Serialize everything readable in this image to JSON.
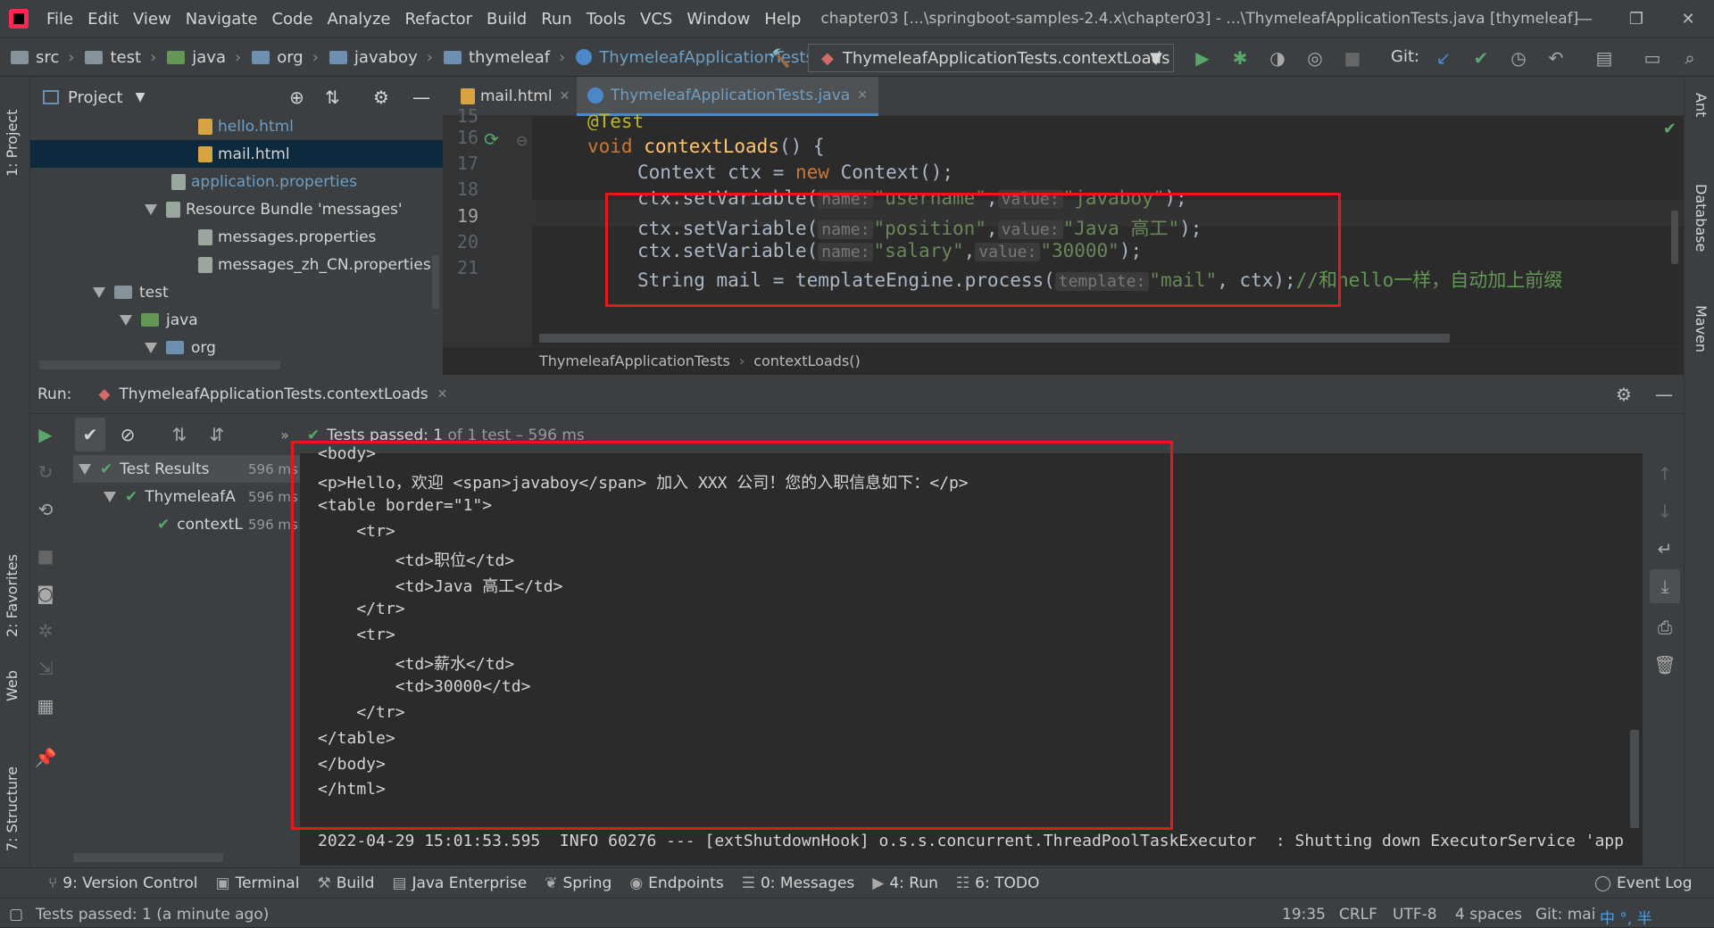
{
  "menubar": {
    "items": [
      "File",
      "Edit",
      "View",
      "Navigate",
      "Code",
      "Analyze",
      "Refactor",
      "Build",
      "Run",
      "Tools",
      "VCS",
      "Window",
      "Help"
    ],
    "title": "chapter03 [...\\springboot-samples-2.4.x\\chapter03] - ...\\ThymeleafApplicationTests.java [thymeleaf]"
  },
  "navbar": {
    "crumbs": [
      "src",
      "test",
      "java",
      "org",
      "javaboy",
      "thymeleaf"
    ],
    "class_crumb": "ThymeleafApplicationTests",
    "run_config": "ThymeleafApplicationTests.contextLoads",
    "git_label": "Git:"
  },
  "sidestrips": {
    "left": [
      "1: Project",
      "2: Favorites",
      "Web",
      "7: Structure"
    ],
    "right": [
      "Ant",
      "Database",
      "Maven"
    ]
  },
  "project": {
    "title": "Project",
    "items": [
      {
        "label": "hello.html"
      },
      {
        "label": "mail.html"
      },
      {
        "label": "application.properties"
      },
      {
        "label": "Resource Bundle 'messages'"
      },
      {
        "label": "messages.properties"
      },
      {
        "label": "messages_zh_CN.properties"
      },
      {
        "label": "test"
      },
      {
        "label": "java"
      },
      {
        "label": "org"
      }
    ]
  },
  "editor": {
    "tabs": [
      "mail.html",
      "ThymeleafApplicationTests.java"
    ],
    "line_numbers": [
      "15",
      "16",
      "17",
      "18",
      "19",
      "20",
      "21"
    ],
    "lines": {
      "l15": "@Test",
      "l16_kw": "void",
      "l16_fn": "contextLoads",
      "l16_rest": "() {",
      "l17_a": "Context ctx = ",
      "l17_kw": "new",
      "l17_b": " Context();",
      "l18_a": "ctx.setVariable(",
      "l18_h1": "name:",
      "l18_s1": "\"username\"",
      "l18_h2": "value:",
      "l18_s2": "\"javaboy\"",
      "l18_end": ");",
      "l19_a": "ctx.setVariable(",
      "l19_h1": "name:",
      "l19_s1": "\"position\"",
      "l19_h2": "value:",
      "l19_s2": "\"Java 高工\"",
      "l19_end": ");",
      "l20_a": "ctx.setVariable(",
      "l20_h1": "name:",
      "l20_s1": "\"salary\"",
      "l20_h2": "value:",
      "l20_s2": "\"30000\"",
      "l20_end": ");",
      "l21_a": "String mail = templateEngine.process(",
      "l21_h1": "template:",
      "l21_s1": "\"mail\"",
      "l21_b": ", ctx);",
      "l21_cmt": "//和hello一样，自动加上前缀"
    },
    "breadcrumb": [
      "ThymeleafApplicationTests",
      "contextLoads()"
    ]
  },
  "run": {
    "label": "Run:",
    "config": "ThymeleafApplicationTests.contextLoads",
    "status_prefix": "Tests passed:",
    "status_count": "1",
    "status_suffix": "of 1 test",
    "status_time": "– 596 ms",
    "tree": [
      {
        "label": "Test Results",
        "time": "596 ms"
      },
      {
        "label": "ThymeleafA",
        "time": "596 ms"
      },
      {
        "label": "contextL",
        "time": "596 ms"
      }
    ],
    "console": [
      "<body>",
      "<p>Hello，欢迎 <span>javaboy</span> 加入 XXX 公司！您的入职信息如下：</p>",
      "<table border=\"1\">",
      "    <tr>",
      "        <td>职位</td>",
      "        <td>Java 高工</td>",
      "    </tr>",
      "    <tr>",
      "        <td>薪水</td>",
      "        <td>30000</td>",
      "    </tr>",
      "</table>",
      "</body>",
      "</html>",
      "",
      "2022-04-29 15:01:53.595  INFO 60276 --- [extShutdownHook] o.s.s.concurrent.ThreadPoolTaskExecutor  : Shutting down ExecutorService 'app"
    ]
  },
  "bottombar": {
    "tools": [
      "9: Version Control",
      "Terminal",
      "Build",
      "Java Enterprise",
      "Spring",
      "Endpoints",
      "0: Messages",
      "4: Run",
      "6: TODO"
    ],
    "event_log": "Event Log"
  },
  "statusbar": {
    "message": "Tests passed: 1 (a minute ago)",
    "position": "19:35",
    "line_sep": "CRLF",
    "encoding": "UTF-8",
    "indent": "4 spaces",
    "git": "Git: mai",
    "ime": "中 °, 半"
  },
  "colors": {
    "highlight_box": "#e5181b",
    "pass_green": "#59a869",
    "active_tab_accent": "#4a88c7"
  }
}
